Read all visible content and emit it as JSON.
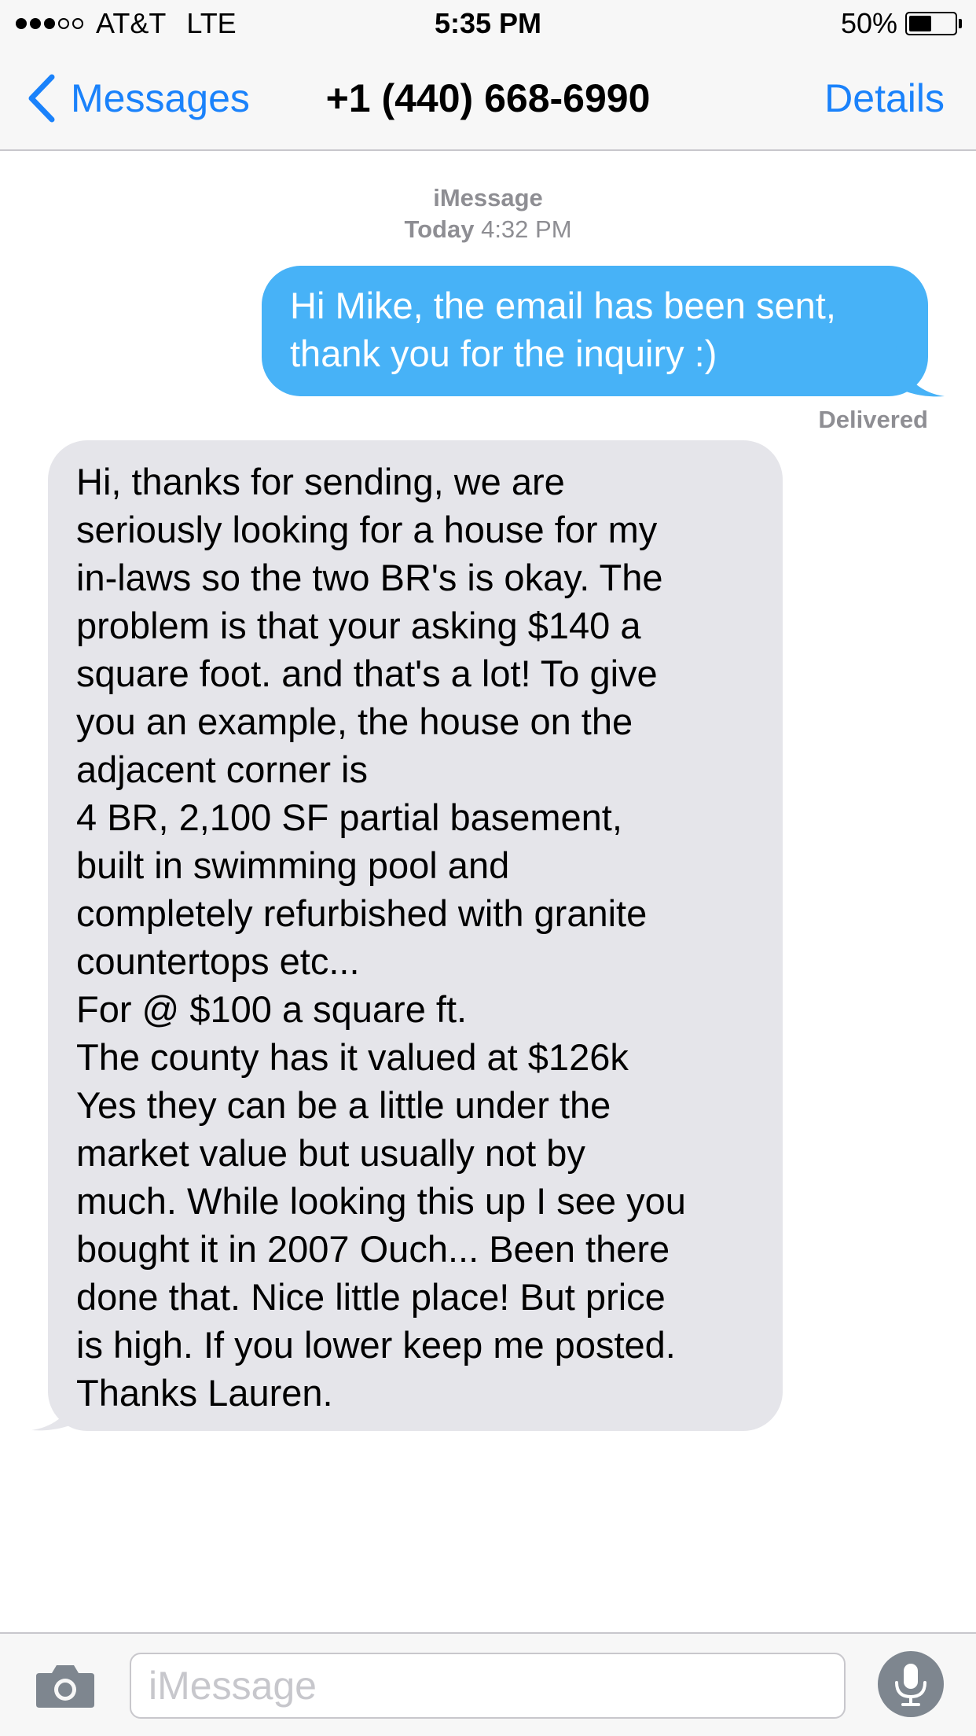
{
  "status_bar": {
    "signal_dots_filled": 3,
    "signal_dots_total": 5,
    "carrier": "AT&T",
    "network": "LTE",
    "time": "5:35 PM",
    "battery_percent_label": "50%",
    "battery_level": 0.5
  },
  "nav": {
    "back_label": "Messages",
    "title": "+1 (440) 668-6990",
    "details_label": "Details"
  },
  "conversation": {
    "service": "iMessage",
    "date_day": "Today",
    "date_time": "4:32 PM",
    "messages": [
      {
        "direction": "outgoing",
        "text": "Hi Mike, the email has been sent,\nthank you for the inquiry :)"
      },
      {
        "direction": "incoming",
        "text": "Hi, thanks for sending, we are\nseriously looking for a house for my\nin-laws so the two BR's is okay. The\nproblem is that your asking $140 a\nsquare foot. and that's a lot! To give\nyou an example, the house on the\nadjacent corner is\n4 BR, 2,100 SF partial basement,\nbuilt in swimming pool and\ncompletely refurbished with granite\ncountertops etc...\nFor @ $100 a square ft.\nThe county has it valued at $126k\nYes they can be a little under the\nmarket value but usually not by\nmuch. While looking this up I see you\nbought it in 2007 Ouch... Been there\ndone that. Nice little place! But price\nis high. If you lower keep me posted.\nThanks Lauren."
      }
    ],
    "delivered_label": "Delivered"
  },
  "input": {
    "placeholder": "iMessage",
    "value": ""
  },
  "icons": {
    "back": "chevron-left-icon",
    "camera": "camera-icon",
    "mic": "microphone-icon"
  },
  "colors": {
    "accent": "#1a82fb",
    "outgoing_bubble": "#47b2f7",
    "incoming_bubble": "#e5e5ea",
    "bar_background": "#f7f7f7",
    "secondary_text": "#8e8e93",
    "mic_button": "#7e868f"
  }
}
